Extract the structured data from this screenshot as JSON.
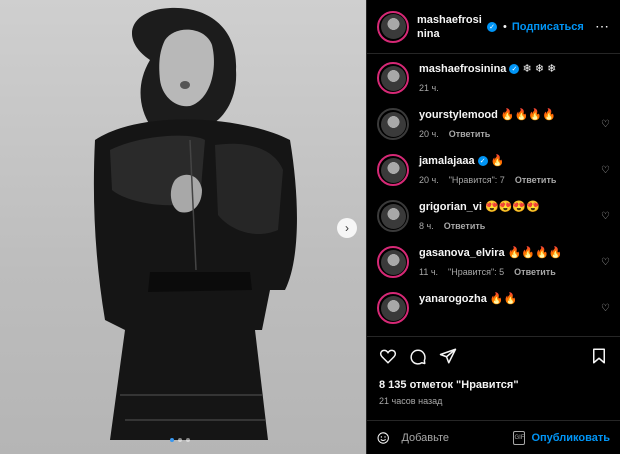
{
  "post": {
    "author": "mashaefrosinina",
    "follow_label": "Подписаться",
    "caption_author": "mashaefrosinina",
    "caption_text": "❄ ❄ ❄",
    "caption_time": "21 ч.",
    "likes_text": "8 135 отметок \"Нравится\"",
    "posted_ago": "21 часов назад",
    "comment_placeholder": "Добавьте",
    "publish_label": "Опубликовать",
    "carousel_count": 3,
    "carousel_active": 1
  },
  "comments": [
    {
      "user": "yourstylemood",
      "verified": false,
      "text": "🔥🔥🔥🔥",
      "time": "20 ч.",
      "likes": "",
      "reply": "Ответить"
    },
    {
      "user": "jamalajaaa",
      "verified": true,
      "text": "🔥",
      "time": "20 ч.",
      "likes": "\"Нравится\": 7",
      "reply": "Ответить"
    },
    {
      "user": "grigorian_vi",
      "verified": false,
      "text": "😍😍😍😍",
      "time": "8 ч.",
      "likes": "",
      "reply": "Ответить"
    },
    {
      "user": "gasanova_elvira",
      "verified": false,
      "text": "🔥🔥🔥🔥",
      "time": "11 ч.",
      "likes": "\"Нравится\": 5",
      "reply": "Ответить"
    },
    {
      "user": "yanarogozha",
      "verified": false,
      "text": "🔥🔥",
      "time": "",
      "likes": "",
      "reply": ""
    }
  ],
  "icons": {
    "like": "heart-icon",
    "comment": "comment-icon",
    "share": "share-icon",
    "save": "bookmark-icon",
    "emoji": "emoji-icon",
    "gif": "gif-icon",
    "more": "more-icon",
    "next": "chevron-right-icon"
  },
  "colors": {
    "accent": "#0095f6",
    "background": "#000000",
    "muted": "#a8a8a8"
  }
}
